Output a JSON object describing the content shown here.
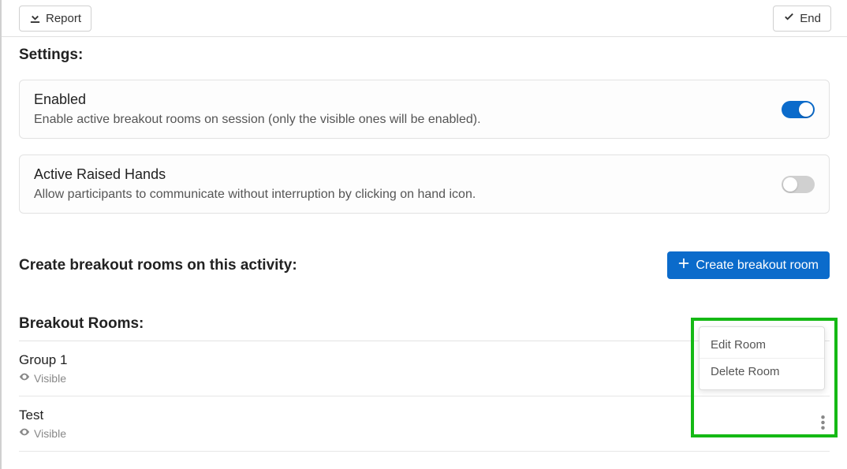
{
  "toolbar": {
    "report_label": "Report",
    "end_label": "End"
  },
  "settings": {
    "heading": "Settings:",
    "items": [
      {
        "title": "Enabled",
        "desc": "Enable active breakout rooms on session (only the visible ones will be enabled).",
        "on": true
      },
      {
        "title": "Active Raised Hands",
        "desc": "Allow participants to communicate without interruption by clicking on hand icon.",
        "on": false
      }
    ]
  },
  "create": {
    "heading": "Create breakout rooms on this activity:",
    "button_label": "Create breakout room"
  },
  "rooms": {
    "heading": "Breakout Rooms:",
    "items": [
      {
        "name": "Group 1",
        "visibility": "Visible"
      },
      {
        "name": "Test",
        "visibility": "Visible"
      }
    ]
  },
  "menu": {
    "edit_label": "Edit Room",
    "delete_label": "Delete Room"
  }
}
